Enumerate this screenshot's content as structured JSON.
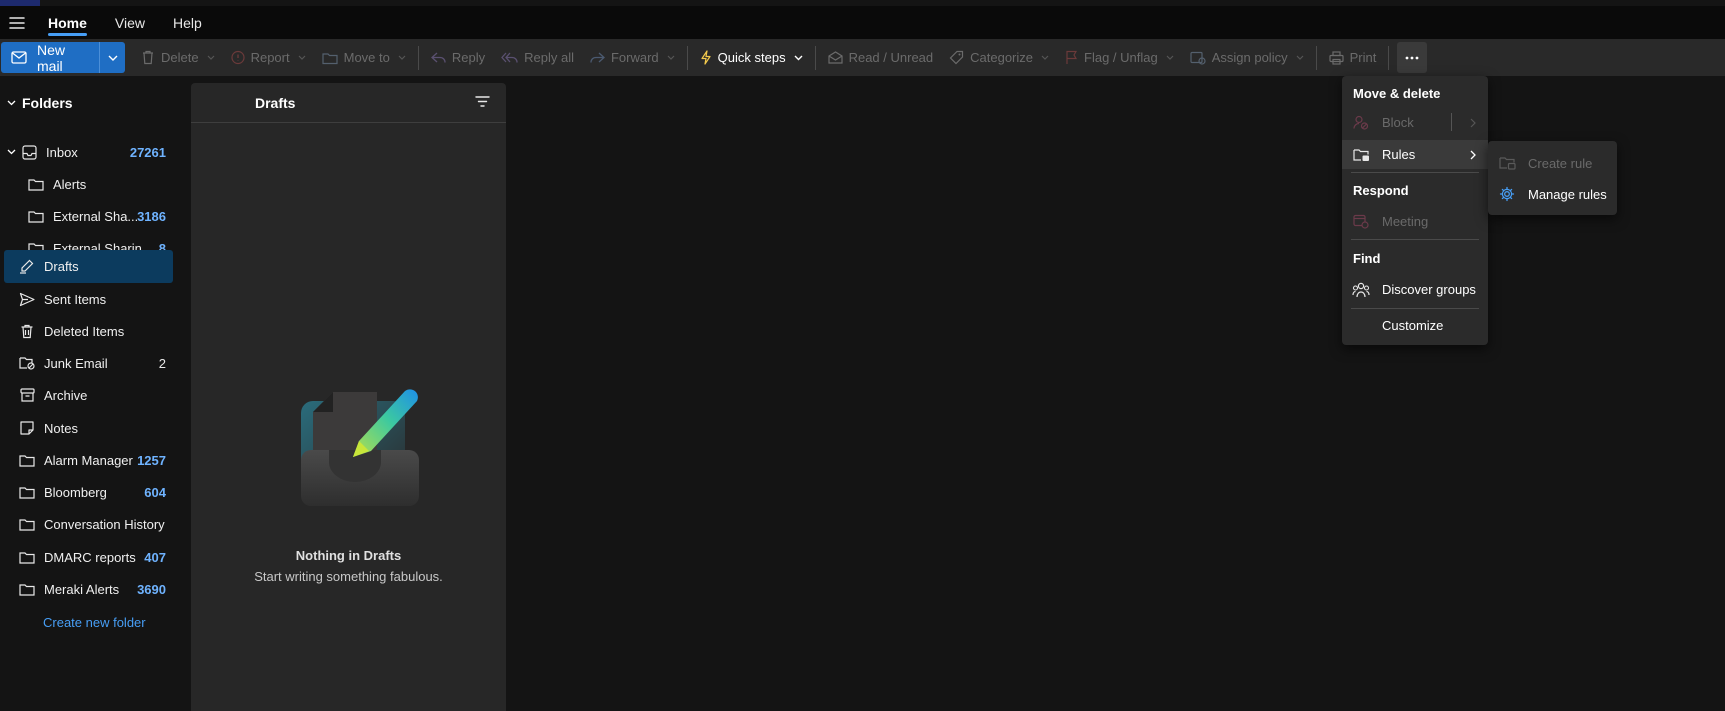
{
  "menu": {
    "tabs": [
      "Home",
      "View",
      "Help"
    ]
  },
  "ribbon": {
    "new_mail": "New mail",
    "delete": "Delete",
    "report": "Report",
    "move_to": "Move to",
    "reply": "Reply",
    "reply_all": "Reply all",
    "forward": "Forward",
    "quick_steps": "Quick steps",
    "read_unread": "Read / Unread",
    "categorize": "Categorize",
    "flag_unflag": "Flag / Unflag",
    "assign_policy": "Assign policy",
    "print": "Print"
  },
  "sidebar": {
    "header": "Folders",
    "items": [
      {
        "label": "Inbox",
        "count": "27261"
      },
      {
        "label": "Alerts",
        "count": ""
      },
      {
        "label": "External Sha...",
        "count": "3186"
      },
      {
        "label": "External Sharin...",
        "count": "8"
      },
      {
        "label": "Drafts",
        "count": ""
      },
      {
        "label": "Sent Items",
        "count": ""
      },
      {
        "label": "Deleted Items",
        "count": ""
      },
      {
        "label": "Junk Email",
        "count": "2"
      },
      {
        "label": "Archive",
        "count": ""
      },
      {
        "label": "Notes",
        "count": ""
      },
      {
        "label": "Alarm Manager",
        "count": "1257"
      },
      {
        "label": "Bloomberg",
        "count": "604"
      },
      {
        "label": "Conversation History",
        "count": ""
      },
      {
        "label": "DMARC reports",
        "count": "407"
      },
      {
        "label": "Meraki Alerts",
        "count": "3690"
      }
    ],
    "create_folder": "Create new folder"
  },
  "list": {
    "title": "Drafts",
    "empty_title": "Nothing in Drafts",
    "empty_subtitle": "Start writing something fabulous."
  },
  "dropdown": {
    "section_move_delete": "Move & delete",
    "block": "Block",
    "rules": "Rules",
    "section_respond": "Respond",
    "meeting": "Meeting",
    "section_find": "Find",
    "discover_groups": "Discover groups",
    "customize": "Customize"
  },
  "submenu": {
    "create_rule": "Create rule",
    "manage_rules": "Manage rules"
  },
  "colors": {
    "accent": "#479ef5",
    "primary_button": "#1f6ec4",
    "selected_folder": "#0c3b5e",
    "count": "#6fb3ff"
  }
}
